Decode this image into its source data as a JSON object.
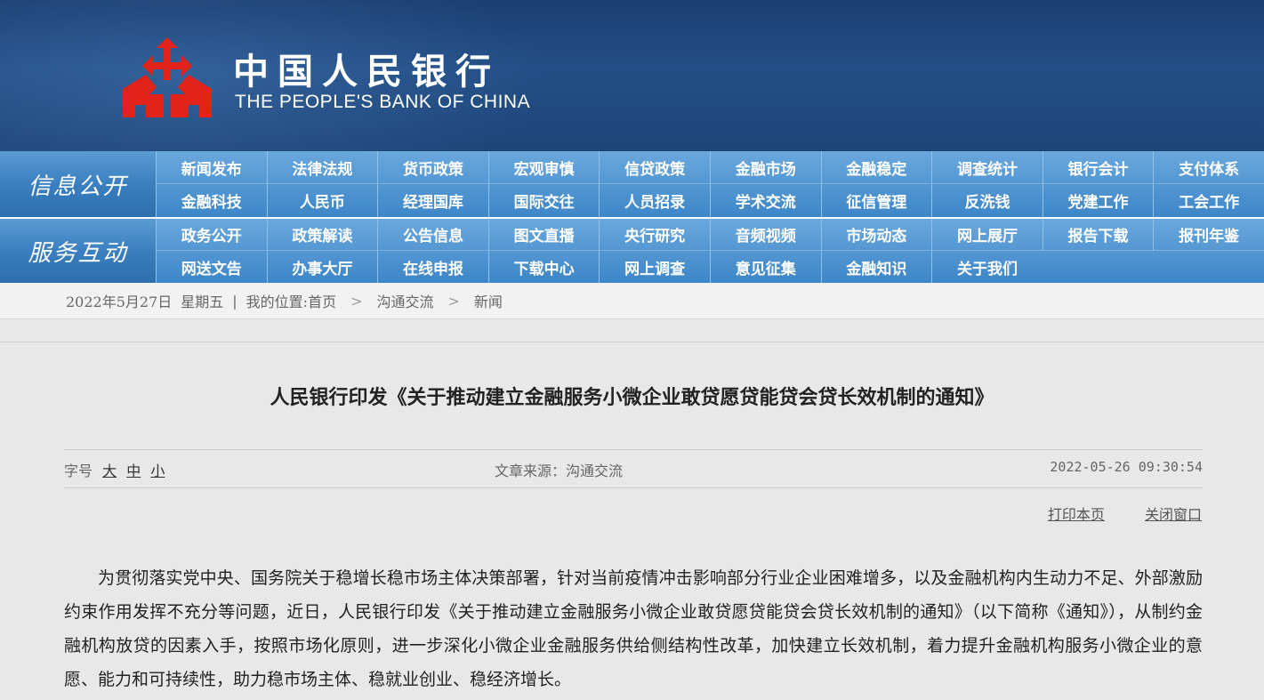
{
  "header": {
    "logo_cn": "中国人民银行",
    "logo_en": "THE PEOPLE'S BANK OF CHINA"
  },
  "nav": {
    "section1_label": "信息公开",
    "section1_row1": [
      "新闻发布",
      "法律法规",
      "货币政策",
      "宏观审慎",
      "信贷政策",
      "金融市场",
      "金融稳定",
      "调查统计",
      "银行会计",
      "支付体系"
    ],
    "section1_row2": [
      "金融科技",
      "人民币",
      "经理国库",
      "国际交往",
      "人员招录",
      "学术交流",
      "征信管理",
      "反洗钱",
      "党建工作",
      "工会工作"
    ],
    "section2_label": "服务互动",
    "section2_row1": [
      "政务公开",
      "政策解读",
      "公告信息",
      "图文直播",
      "央行研究",
      "音频视频",
      "市场动态",
      "网上展厅",
      "报告下载",
      "报刊年鉴"
    ],
    "section2_row2": [
      "网送文告",
      "办事大厅",
      "在线申报",
      "下载中心",
      "网上调查",
      "意见征集",
      "金融知识",
      "关于我们"
    ]
  },
  "breadcrumb": {
    "date": "2022年5月27日",
    "weekday": "星期五",
    "divider": "|",
    "location_label": "我的位置:首页",
    "level2": "沟通交流",
    "level3": "新闻",
    "chevron": ">"
  },
  "article": {
    "title": "人民银行印发《关于推动建立金融服务小微企业敢贷愿贷能贷会贷长效机制的通知》",
    "font_size_label": "字号",
    "font_large": "大",
    "font_medium": "中",
    "font_small": "小",
    "source": "文章来源：沟通交流",
    "datetime": "2022-05-26  09:30:54",
    "print_label": "打印本页",
    "close_label": "关闭窗口",
    "paragraph": "为贯彻落实党中央、国务院关于稳增长稳市场主体决策部署，针对当前疫情冲击影响部分行业企业困难增多，以及金融机构内生动力不足、外部激励约束作用发挥不充分等问题，近日，人民银行印发《关于推动建立金融服务小微企业敢贷愿贷能贷会贷长效机制的通知》（以下简称《通知》），从制约金融机构放贷的因素入手，按照市场化原则，进一步深化小微企业金融服务供给侧结构性改革，加快建立长效机制，着力提升金融机构服务小微企业的意愿、能力和可持续性，助力稳市场主体、稳就业创业、稳经济增长。"
  },
  "colors": {
    "banner": "#1d4578",
    "logo_red": "#e2231a",
    "nav_blue": "#3d86c8"
  }
}
